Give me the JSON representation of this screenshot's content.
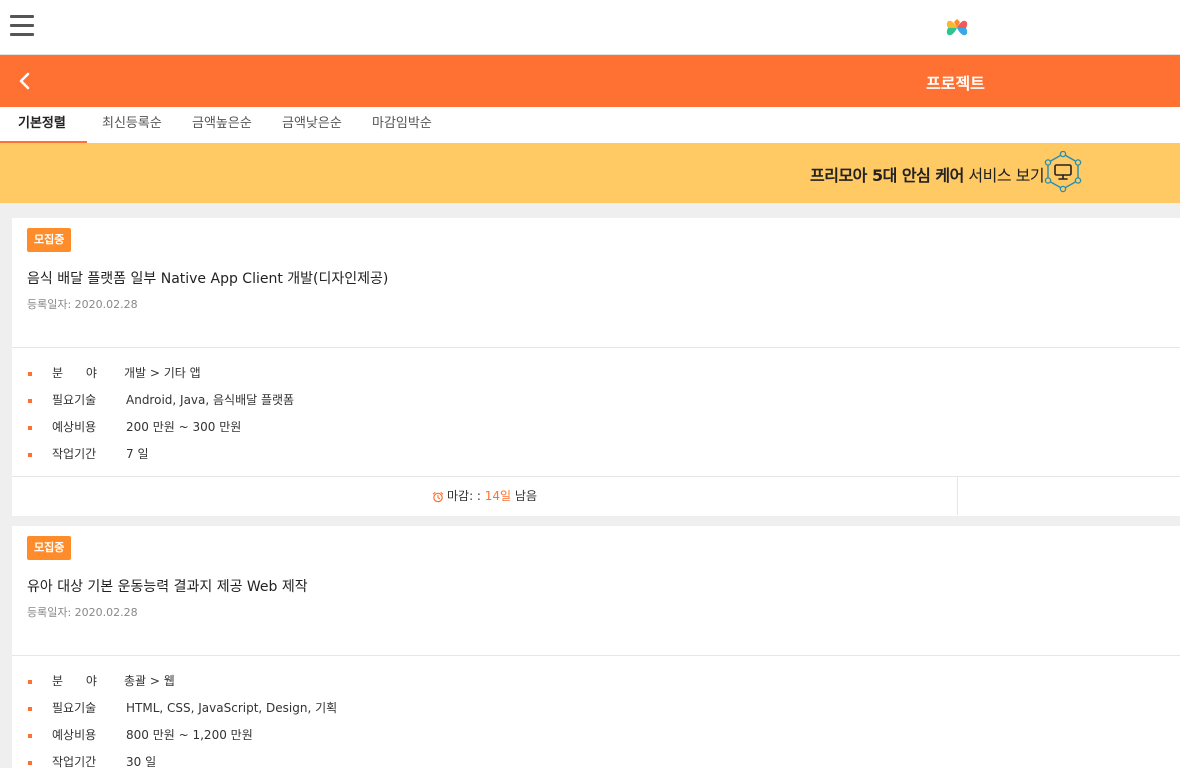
{
  "header": {
    "menu_icon": "hamburger-icon",
    "logo_icon": "clover-logo"
  },
  "nav": {
    "back_icon": "chevron-left-icon",
    "title": "프로젝트"
  },
  "sort_tabs": [
    "기본정렬",
    "최신등록순",
    "금액높은순",
    "금액낮은순",
    "마감임박순"
  ],
  "banner": {
    "bold_text": "프리모아 5대 안심 케어",
    "text": " 서비스 보기",
    "icon": "monitor-network-icon"
  },
  "projects": [
    {
      "status": "모집중",
      "title": "음식 배달 플랫폼 일부 Native App Client 개발(디자인제공)",
      "date": "등록일자: 2020.02.28",
      "fields": [
        {
          "label": "분      야",
          "value": "개발 > 기타 앱"
        },
        {
          "label": "필요기술",
          "value": "Android, Java, 음식배달 플랫폼"
        },
        {
          "label": "예상비용",
          "value": "200 만원 ~ 300 만원"
        },
        {
          "label": "작업기간",
          "value": "7 일"
        }
      ],
      "deadline_prefix": "마감: : ",
      "deadline_days": "14일",
      "deadline_suffix": " 남음"
    },
    {
      "status": "모집중",
      "title": "유아 대상 기본 운동능력 결과지 제공 Web 제작",
      "date": "등록일자: 2020.02.28",
      "fields": [
        {
          "label": "분      야",
          "value": "총괄 > 웹"
        },
        {
          "label": "필요기술",
          "value": "HTML, CSS, JavaScript, Design, 기획"
        },
        {
          "label": "예상비용",
          "value": "800 만원 ~ 1,200 만원"
        },
        {
          "label": "작업기간",
          "value": "30 일"
        }
      ]
    }
  ],
  "colors": {
    "accent": "#ff7132",
    "banner": "#ffc964",
    "badge": "#ff8c2b"
  }
}
